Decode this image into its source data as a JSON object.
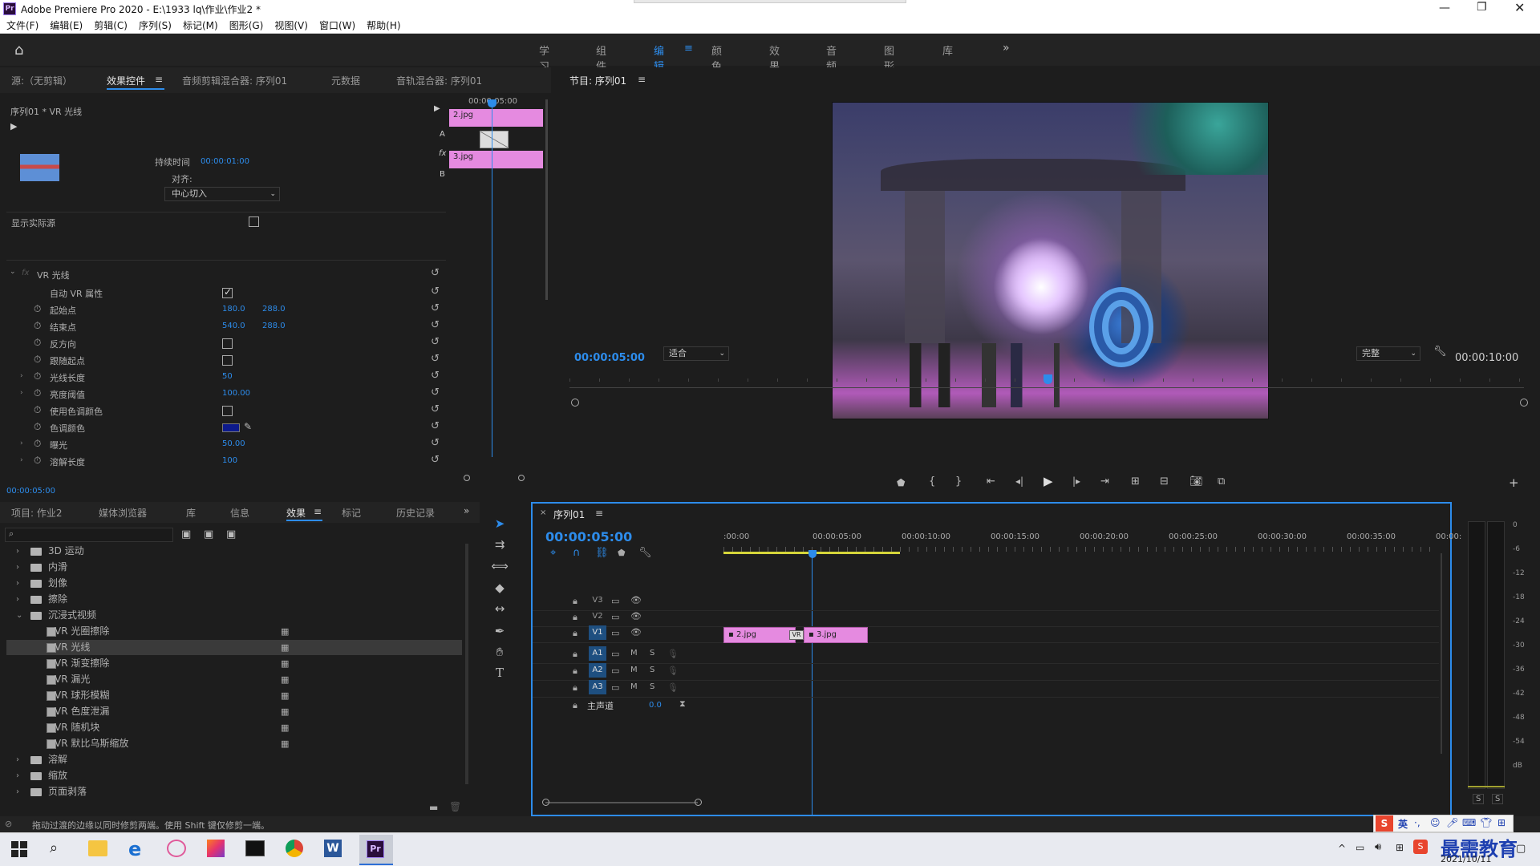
{
  "titlebar": {
    "app_icon": "Pr",
    "title": "Adobe Premiere Pro 2020 - E:\\1933 lq\\作业\\作业2 *"
  },
  "menu": [
    "文件(F)",
    "编辑(E)",
    "剪辑(C)",
    "序列(S)",
    "标记(M)",
    "图形(G)",
    "视图(V)",
    "窗口(W)",
    "帮助(H)"
  ],
  "workspaces": [
    "学习",
    "组件",
    "编辑",
    "颜色",
    "效果",
    "音频",
    "图形",
    "库"
  ],
  "workspace_active": "编辑",
  "effect_controls": {
    "tabs": [
      "源:（无剪辑）",
      "效果控件",
      "音频剪辑混合器: 序列01",
      "元数据",
      "音轨混合器: 序列01"
    ],
    "header": "序列01 * VR 光线",
    "mini_timecode": "00:00:05:00",
    "duration_label": "持续时间",
    "duration_value": "00:00:01:00",
    "align_label": "对齐:",
    "align_value": "中心切入",
    "clip_a": "2.jpg",
    "clip_b": "3.jpg",
    "label_a": "A",
    "label_b": "B",
    "label_fx": "fx",
    "show_source": "显示实际源",
    "effect_name": "VR 光线",
    "fx_badge": "fx",
    "properties": [
      {
        "name": "自动 VR 属性",
        "type": "check",
        "on": true
      },
      {
        "name": "起始点",
        "v1": "180.0",
        "v2": "288.0"
      },
      {
        "name": "结束点",
        "v1": "540.0",
        "v2": "288.0"
      },
      {
        "name": "反方向",
        "type": "check",
        "on": false
      },
      {
        "name": "跟随起点",
        "type": "check",
        "on": false
      },
      {
        "name": "光线长度",
        "v1": "50"
      },
      {
        "name": "亮度阈值",
        "v1": "100.00"
      },
      {
        "name": "使用色调颜色",
        "type": "check",
        "on": false
      },
      {
        "name": "色调颜色",
        "type": "color",
        "color": "#0d1a8c"
      },
      {
        "name": "曝光",
        "v1": "50.00"
      },
      {
        "name": "溶解长度",
        "v1": "100"
      }
    ],
    "footer_timecode": "00:00:05:00"
  },
  "program": {
    "title": "节目: 序列01",
    "timecode": "00:00:05:00",
    "fit": "适合",
    "quality": "完整",
    "duration": "00:00:10:00"
  },
  "project": {
    "tabs": [
      "项目: 作业2",
      "媒体浏览器",
      "库",
      "信息",
      "效果",
      "标记",
      "历史记录"
    ],
    "active_tab": "效果",
    "search_placeholder": "",
    "tree": [
      {
        "label": "3D 运动",
        "kind": "folder",
        "depth": 0,
        "open": false
      },
      {
        "label": "内滑",
        "kind": "folder",
        "depth": 0,
        "open": false
      },
      {
        "label": "划像",
        "kind": "folder",
        "depth": 0,
        "open": false
      },
      {
        "label": "擦除",
        "kind": "folder",
        "depth": 0,
        "open": false
      },
      {
        "label": "沉浸式视频",
        "kind": "folder",
        "depth": 0,
        "open": true
      },
      {
        "label": "VR 光圈擦除",
        "kind": "fx",
        "depth": 1
      },
      {
        "label": "VR 光线",
        "kind": "fx",
        "depth": 1,
        "selected": true
      },
      {
        "label": "VR 渐变擦除",
        "kind": "fx",
        "depth": 1
      },
      {
        "label": "VR 漏光",
        "kind": "fx",
        "depth": 1
      },
      {
        "label": "VR 球形模糊",
        "kind": "fx",
        "depth": 1
      },
      {
        "label": "VR 色度泄漏",
        "kind": "fx",
        "depth": 1
      },
      {
        "label": "VR 随机块",
        "kind": "fx",
        "depth": 1
      },
      {
        "label": "VR 默比乌斯缩放",
        "kind": "fx",
        "depth": 1
      },
      {
        "label": "溶解",
        "kind": "folder",
        "depth": 0,
        "open": false
      },
      {
        "label": "缩放",
        "kind": "folder",
        "depth": 0,
        "open": false
      },
      {
        "label": "页面剥落",
        "kind": "folder",
        "depth": 0,
        "open": false
      }
    ]
  },
  "timeline": {
    "title": "序列01",
    "timecode": "00:00:05:00",
    "ruler": [
      ":00:00",
      "00:00:05:00",
      "00:00:10:00",
      "00:00:15:00",
      "00:00:20:00",
      "00:00:25:00",
      "00:00:30:00",
      "00:00:35:00",
      "00:00:"
    ],
    "video_tracks": [
      "V3",
      "V2",
      "V1"
    ],
    "audio_tracks": [
      "A1",
      "A2",
      "A3"
    ],
    "master_label": "主声道",
    "master_value": "0.0",
    "mute_label": "M",
    "solo_label": "S",
    "clips": [
      {
        "label": "2.jpg"
      },
      {
        "label": "3.jpg"
      }
    ],
    "transition_label": "VR"
  },
  "meter": {
    "labels": [
      "0",
      "-6",
      "-12",
      "-18",
      "-24",
      "-30",
      "-36",
      "-42",
      "-48",
      "-54",
      "dB"
    ],
    "solo": [
      "S",
      "S"
    ]
  },
  "statusbar": {
    "hint": "拖动过渡的边缘以同时修剪两端。使用 Shift 键仅修剪一端。"
  },
  "taskbar": {
    "apps": [
      "windows",
      "search",
      "explorer",
      "edge",
      "paint",
      "jetbrains",
      "terminal",
      "chrome",
      "word",
      "premiere"
    ],
    "ime": "英",
    "watermark": "最需教育",
    "date": "2021/10/11"
  }
}
